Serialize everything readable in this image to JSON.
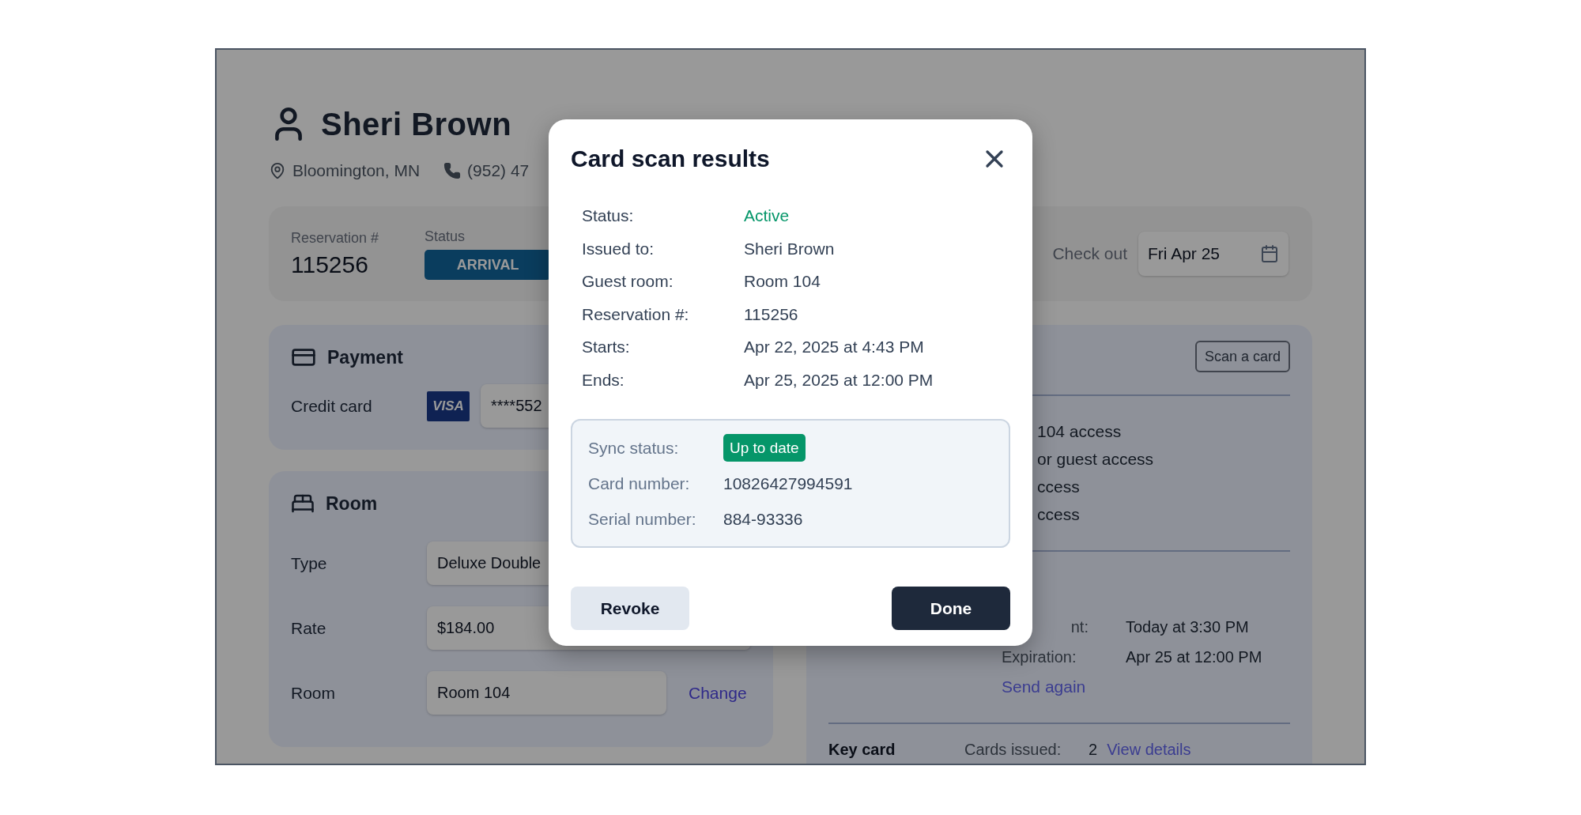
{
  "guest": {
    "name": "Sheri Brown",
    "location": "Bloomington, MN",
    "phone": "(952) 47"
  },
  "reservation": {
    "number_label": "Reservation #",
    "number": "115256",
    "status_label": "Status",
    "status": "ARRIVAL",
    "checkout_label": "Check out",
    "checkout": "Fri Apr 25"
  },
  "payment": {
    "title": "Payment",
    "card_label": "Credit card",
    "card_brand": "VISA",
    "card_number": "****552"
  },
  "room": {
    "title": "Room",
    "fields": [
      {
        "label": "Type",
        "value": "Deluxe Double"
      },
      {
        "label": "Rate",
        "value": "$184.00"
      },
      {
        "label": "Room",
        "value": "Room 104"
      }
    ],
    "change_link": "Change"
  },
  "access": {
    "scan_button": "Scan a card",
    "items": [
      "104 access",
      "or guest access",
      "ccess",
      "ccess"
    ],
    "details": [
      {
        "label": "nt:",
        "value": "Today at 3:30 PM"
      },
      {
        "label": "Expiration:",
        "value": "Apr 25 at 12:00 PM"
      }
    ],
    "send_again": "Send again",
    "key_card_label": "Key card",
    "cards_issued_label": "Cards issued:",
    "cards_issued_value": "2",
    "view_details": "View details"
  },
  "modal": {
    "title": "Card scan results",
    "rows": [
      {
        "label": "Status:",
        "value": "Active",
        "kind": "status"
      },
      {
        "label": "Issued to:",
        "value": "Sheri Brown",
        "kind": "text"
      },
      {
        "label": "Guest room:",
        "value": "Room 104",
        "kind": "text"
      },
      {
        "label": "Reservation #:",
        "value": "115256",
        "kind": "text"
      },
      {
        "label": "Starts:",
        "value": "Apr 22, 2025 at 4:43 PM",
        "kind": "text"
      },
      {
        "label": "Ends:",
        "value": "Apr 25, 2025 at 12:00 PM",
        "kind": "text"
      }
    ],
    "sync": [
      {
        "label": "Sync status:",
        "value": "Up to date",
        "kind": "badge"
      },
      {
        "label": "Card number:",
        "value": "10826427994591",
        "kind": "text"
      },
      {
        "label": "Serial number:",
        "value": "884-93336",
        "kind": "text"
      }
    ],
    "buttons": [
      {
        "label": "Revoke",
        "kind": "secondary"
      },
      {
        "label": "Done",
        "kind": "primary"
      }
    ]
  }
}
